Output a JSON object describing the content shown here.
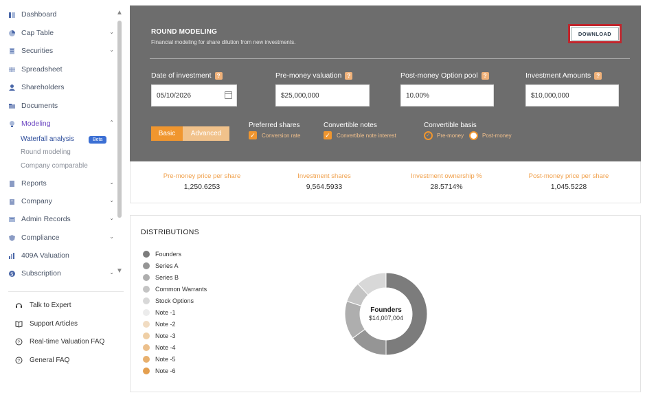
{
  "sidebar": {
    "items": [
      {
        "label": "Dashboard",
        "icon": "dashboard-icon"
      },
      {
        "label": "Cap Table",
        "icon": "pie-chart-icon"
      },
      {
        "label": "Securities",
        "icon": "document-icon"
      },
      {
        "label": "Spreadsheet",
        "icon": "grid-icon"
      },
      {
        "label": "Shareholders",
        "icon": "person-icon"
      },
      {
        "label": "Documents",
        "icon": "folder-icon"
      },
      {
        "label": "Modeling",
        "icon": "bulb-icon"
      },
      {
        "label": "Reports",
        "icon": "report-icon"
      },
      {
        "label": "Company",
        "icon": "building-icon"
      },
      {
        "label": "Admin Records",
        "icon": "records-icon"
      },
      {
        "label": "Compliance",
        "icon": "shield-icon"
      },
      {
        "label": "409A Valuation",
        "icon": "bar-chart-icon"
      },
      {
        "label": "Subscription",
        "icon": "dollar-icon"
      }
    ],
    "modeling_sub": [
      "Waterfall analysis",
      "Round modeling",
      "Company comparable"
    ],
    "beta_badge": "Beta",
    "help": [
      "Talk to Expert",
      "Support Articles",
      "Real-time Valuation FAQ",
      "General FAQ"
    ]
  },
  "panel": {
    "title": "ROUND MODELING",
    "subtitle": "Financial modeling for share dilution from new investments.",
    "download_label": "DOWNLOAD",
    "help_mark": "?",
    "fields": [
      {
        "label": "Date of investment",
        "value": "05/10/2026"
      },
      {
        "label": "Pre-money valuation",
        "value": "$25,000,000"
      },
      {
        "label": "Post-money Option pool",
        "value": "10.00%"
      },
      {
        "label": "Investment Amounts",
        "value": "$10,000,000"
      }
    ],
    "mode_basic": "Basic",
    "mode_advanced": "Advanced",
    "preferred_shares": "Preferred shares",
    "conversion_rate": "Conversion rate",
    "convertible_notes": "Convertible notes",
    "convertible_note_interest": "Convertible note interest",
    "convertible_basis": "Convertible basis",
    "pre_money": "Pre-money",
    "post_money": "Post-money"
  },
  "metrics": [
    {
      "label": "Pre-money price per share",
      "value": "1,250.6253"
    },
    {
      "label": "Investment shares",
      "value": "9,564.5933"
    },
    {
      "label": "Investment ownership %",
      "value": "28.5714%"
    },
    {
      "label": "Post-money price per share",
      "value": "1,045.5228"
    }
  ],
  "distributions": {
    "title": "DISTRIBUTIONS",
    "legend": [
      {
        "name": "Founders",
        "color": "#7c7c7c"
      },
      {
        "name": "Series A",
        "color": "#959595"
      },
      {
        "name": "Series B",
        "color": "#aeaeae"
      },
      {
        "name": "Common Warrants",
        "color": "#c4c4c4"
      },
      {
        "name": "Stock Options",
        "color": "#d8d8d8"
      },
      {
        "name": "Note -1",
        "color": "#ececec"
      },
      {
        "name": "Note -2",
        "color": "#f1dcc2"
      },
      {
        "name": "Note -3",
        "color": "#efcfa6"
      },
      {
        "name": "Note -4",
        "color": "#ecc08c"
      },
      {
        "name": "Note -5",
        "color": "#e8b06e"
      },
      {
        "name": "Note -6",
        "color": "#e49f4f"
      }
    ],
    "center_name": "Founders",
    "center_value": "$14,007,004"
  },
  "chart_data": {
    "type": "pie",
    "categories": [
      "Founders",
      "Series A",
      "Series B",
      "Common Warrants",
      "Stock Options"
    ],
    "values": [
      50,
      15,
      15,
      8,
      12
    ]
  }
}
